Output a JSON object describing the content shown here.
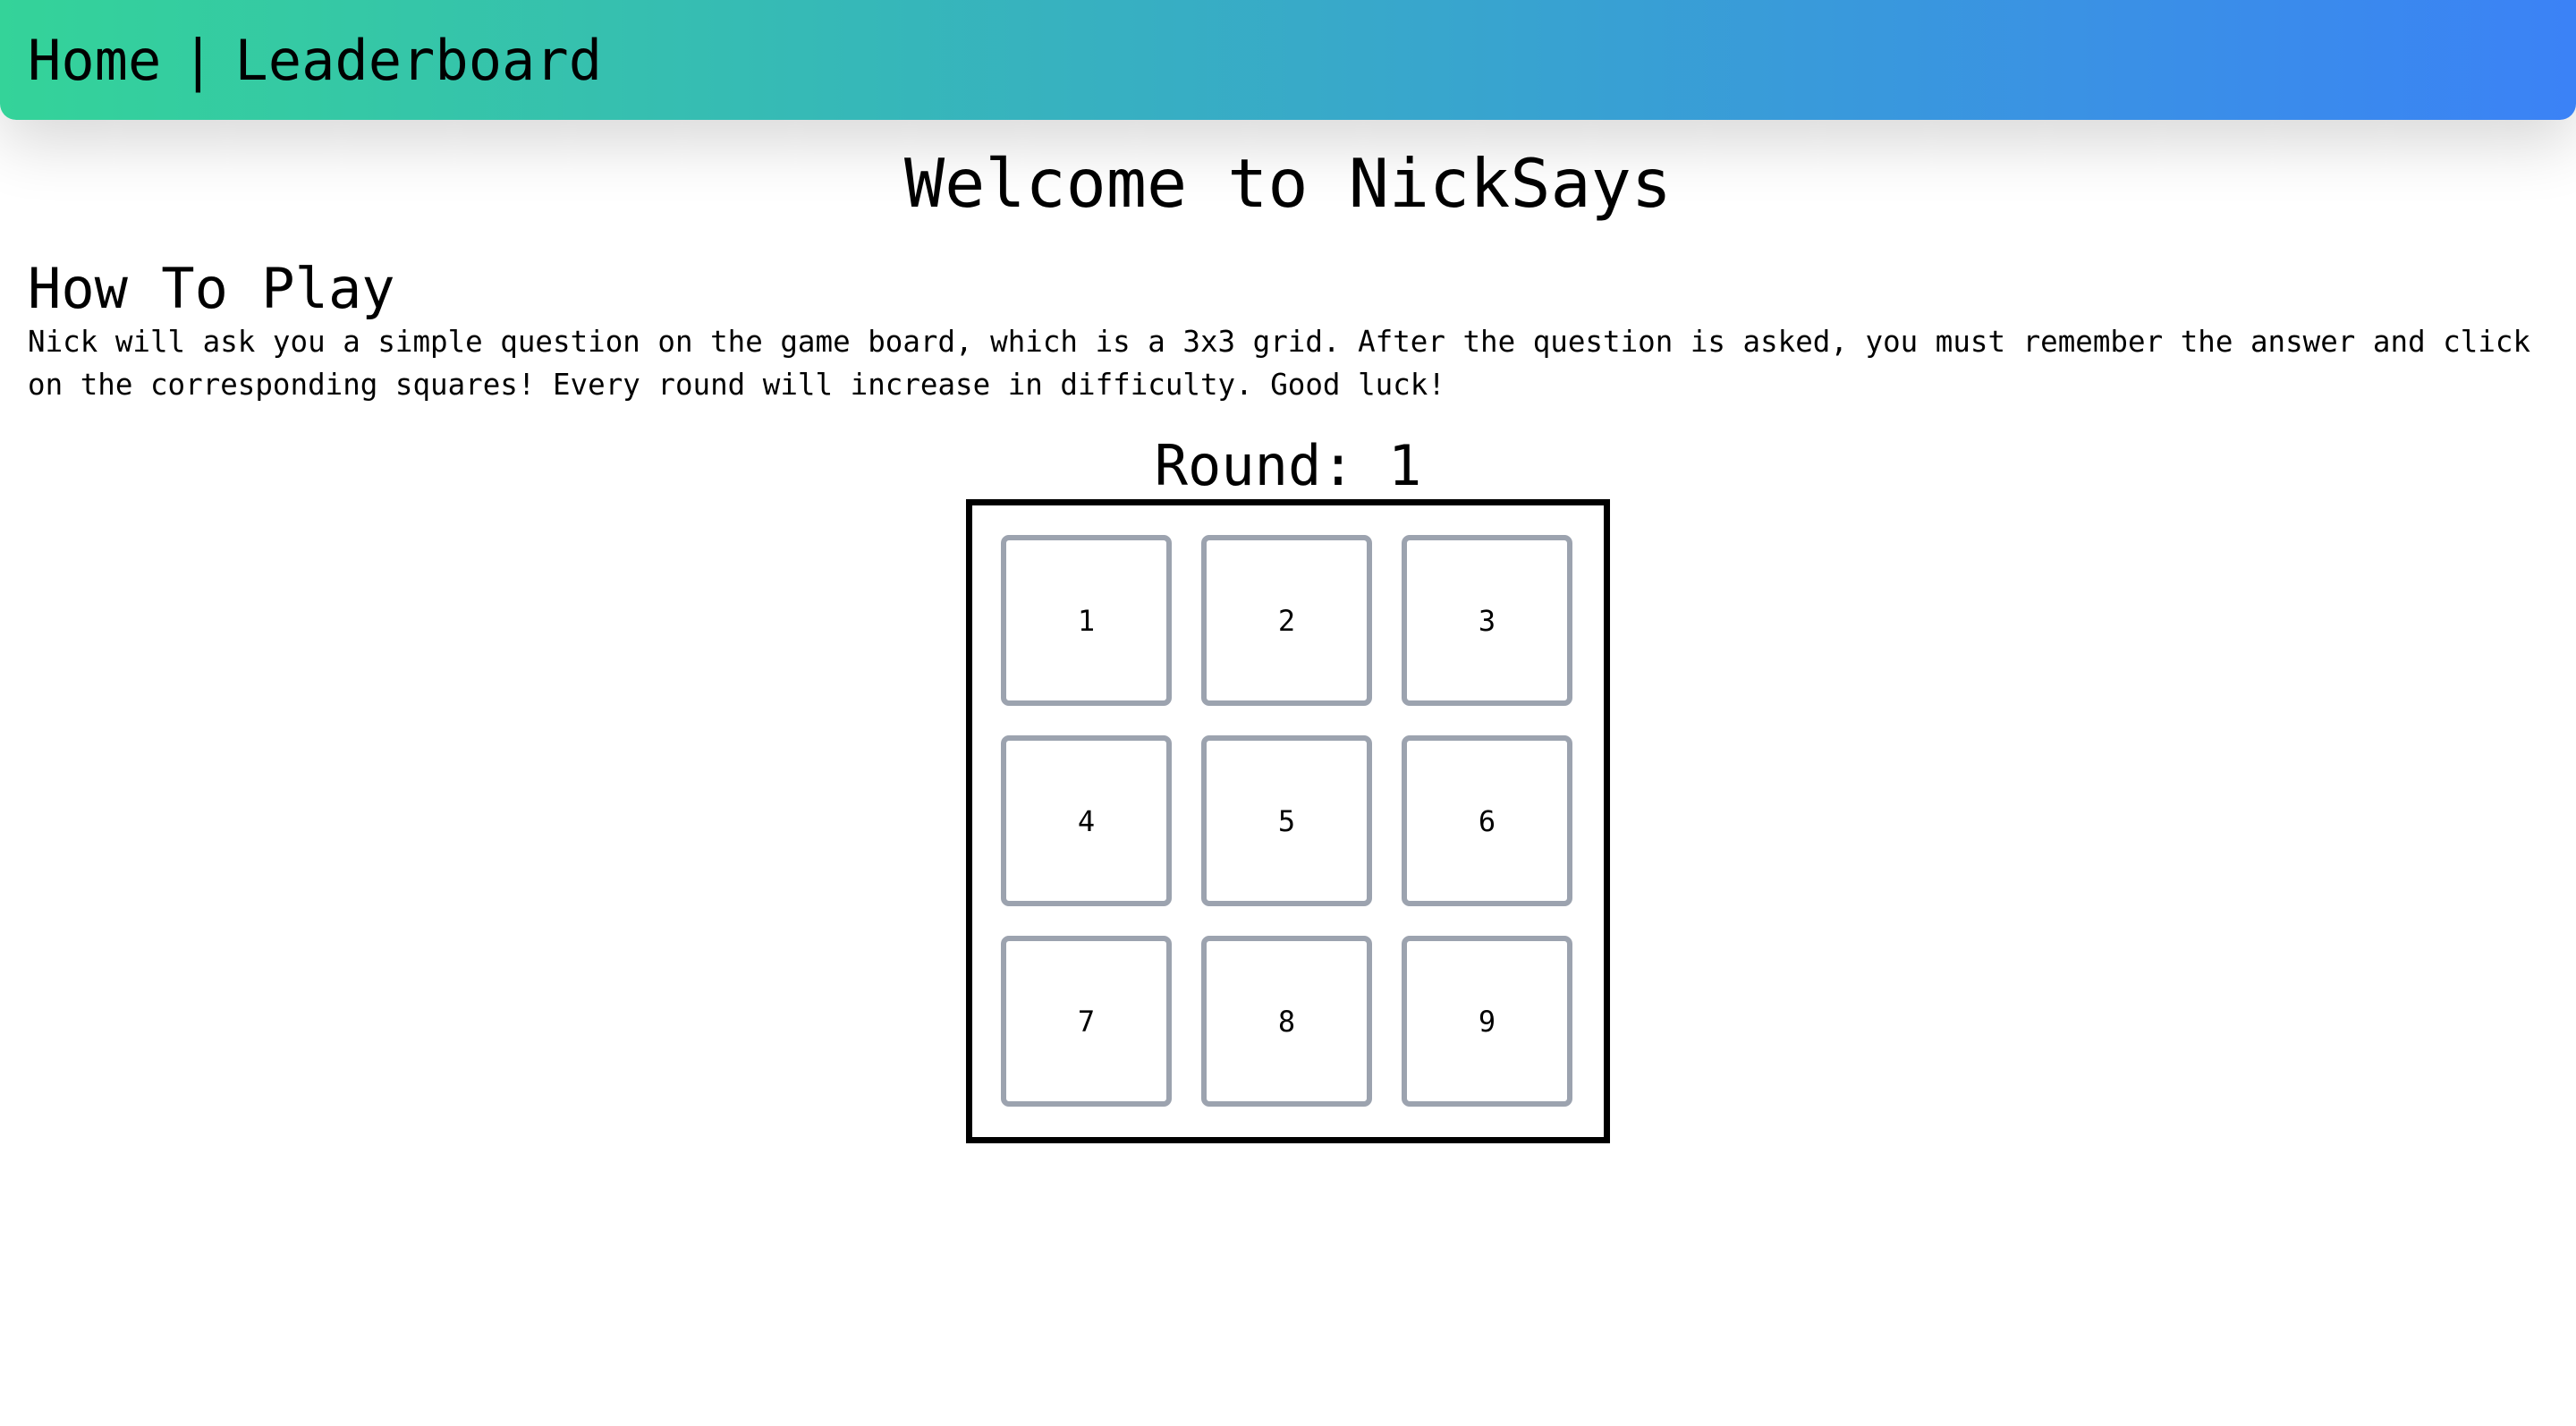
{
  "nav": {
    "home": "Home",
    "separator": "|",
    "leaderboard": "Leaderboard",
    "gradient_start": "#34d399",
    "gradient_end": "#3b82f6"
  },
  "welcome": "Welcome to NickSays",
  "how_to_play": {
    "title": "How To Play",
    "text": "Nick will ask you a simple question on the game board, which is a 3x3 grid. After the question is asked, you must remember the answer and click on the corresponding squares! Every round will increase in difficulty. Good luck!"
  },
  "round": {
    "label": "Round:",
    "value": "1"
  },
  "board": {
    "cell_border_color": "#9ca3af",
    "cells": [
      "1",
      "2",
      "3",
      "4",
      "5",
      "6",
      "7",
      "8",
      "9"
    ]
  }
}
